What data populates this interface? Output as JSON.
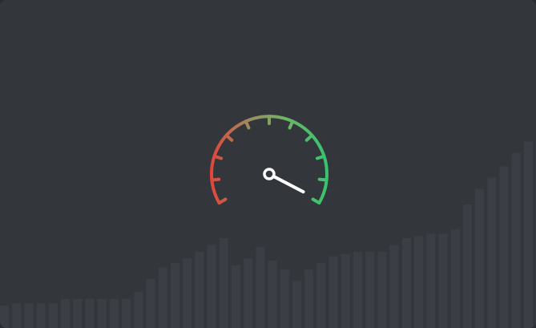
{
  "gauge": {
    "value_fraction": 0.99,
    "icon": "speedometer-icon",
    "colors": {
      "start": "#e2453c",
      "mid": "#9a8f5e",
      "end": "#36c46f",
      "needle": "#ffffff"
    },
    "tick_count": 11
  },
  "background_bars": {
    "color": "#3b3e44",
    "values": [
      0.1,
      0.11,
      0.11,
      0.11,
      0.11,
      0.13,
      0.13,
      0.13,
      0.13,
      0.13,
      0.13,
      0.16,
      0.22,
      0.27,
      0.29,
      0.31,
      0.34,
      0.37,
      0.4,
      0.28,
      0.31,
      0.36,
      0.3,
      0.26,
      0.21,
      0.26,
      0.29,
      0.32,
      0.33,
      0.34,
      0.34,
      0.34,
      0.37,
      0.4,
      0.41,
      0.42,
      0.42,
      0.44,
      0.55,
      0.62,
      0.67,
      0.72,
      0.78,
      0.83
    ]
  }
}
